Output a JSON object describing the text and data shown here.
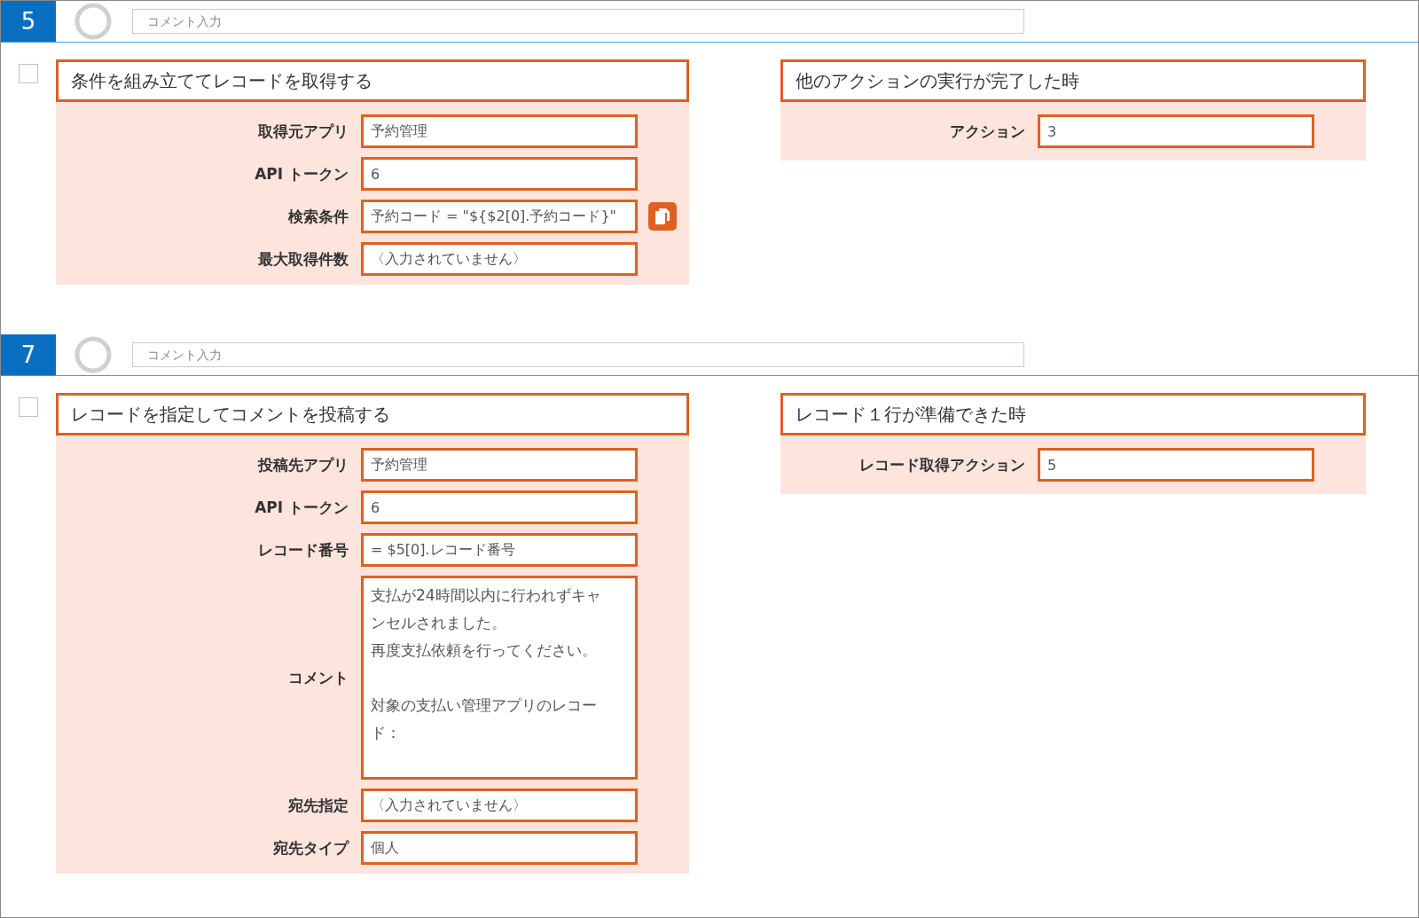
{
  "steps": [
    {
      "number": "5",
      "comment": {
        "placeholder": "コメント入力"
      },
      "checked": false,
      "action": {
        "title": "条件を組み立ててレコードを取得する",
        "fields": [
          {
            "label": "取得元アプリ",
            "value": "予約管理",
            "kind": "text",
            "copy_button": false
          },
          {
            "label": "API トークン",
            "value": "6",
            "kind": "text",
            "copy_button": false
          },
          {
            "label": "検索条件",
            "value": "予約コード = \"${$2[0].予約コード}\"",
            "kind": "text",
            "copy_button": true
          },
          {
            "label": "最大取得件数",
            "value": "〈入力されていません〉",
            "kind": "text",
            "copy_button": false
          }
        ]
      },
      "trigger": {
        "title": "他のアクションの実行が完了した時",
        "fields": [
          {
            "label": "アクション",
            "value": "3",
            "kind": "text",
            "copy_button": false
          }
        ]
      }
    },
    {
      "number": "7",
      "comment": {
        "placeholder": "コメント入力"
      },
      "checked": false,
      "action": {
        "title": "レコードを指定してコメントを投稿する",
        "fields": [
          {
            "label": "投稿先アプリ",
            "value": "予約管理",
            "kind": "text",
            "copy_button": false
          },
          {
            "label": "API トークン",
            "value": "6",
            "kind": "text",
            "copy_button": false
          },
          {
            "label": "レコード番号",
            "value": "= $5[0].レコード番号",
            "kind": "text",
            "copy_button": false
          },
          {
            "label": "コメント",
            "paragraphs": [
              [
                "支払が24時間以内に行われずキャンセルされました。",
                "再度支払依頼を行ってください。"
              ],
              [
                "対象の支払い管理アプリのレコード："
              ]
            ],
            "kind": "multiline",
            "copy_button": false
          },
          {
            "label": "宛先指定",
            "value": "〈入力されていません〉",
            "kind": "text",
            "copy_button": false
          },
          {
            "label": "宛先タイプ",
            "value": "個人",
            "kind": "text",
            "copy_button": false
          }
        ]
      },
      "trigger": {
        "title": "レコード１行が準備できた時",
        "fields": [
          {
            "label": "レコード取得アクション",
            "value": "5",
            "kind": "text",
            "copy_button": false
          }
        ]
      }
    }
  ]
}
